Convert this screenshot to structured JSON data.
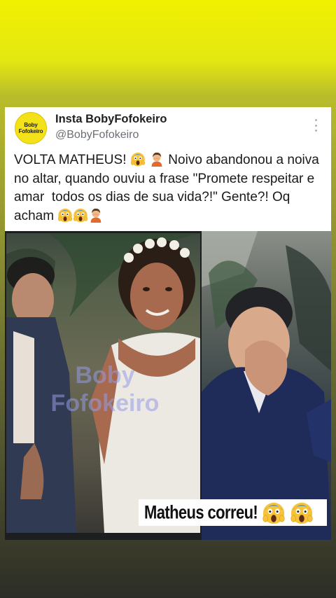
{
  "post": {
    "avatar_text_line1": "Boby",
    "avatar_text_line2": "Fofokeiro",
    "display_name": "Insta BobyFofokeiro",
    "handle": "@BobyFofokeiro",
    "text_part1": "VOLTA MATHEUS! ",
    "text_part2": " Noivo abandonou a noiva no altar, quando ouviu a frase \"Promete respeitar e amar  todos os dias de sua vida?!\" Gente?! Oq acham ",
    "emoji_shocked": "face-screaming-in-fear-icon",
    "emoji_facepalm": "person-facepalming-icon"
  },
  "media": {
    "watermark_line1": "Boby",
    "watermark_line2": "Fofokeiro",
    "caption": "Matheus correu!",
    "caption_emoji_count": 2
  },
  "colors": {
    "background_top": "#f0f000",
    "background_bottom": "#2c2d26",
    "card": "#ffffff",
    "handle_gray": "#6a6f75"
  }
}
